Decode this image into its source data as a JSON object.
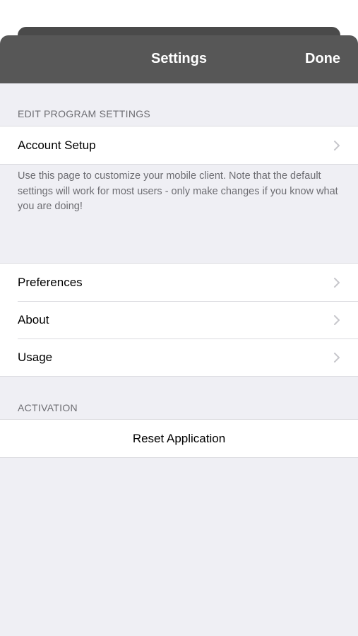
{
  "navbar": {
    "title": "Settings",
    "done_label": "Done"
  },
  "sections": {
    "edit_program": {
      "header": "EDIT PROGRAM SETTINGS",
      "account_setup_label": "Account Setup",
      "footer": "Use this page to customize your mobile client. Note that the default settings will work for most users - only make changes if you know what you are doing!"
    },
    "general": {
      "items": [
        {
          "label": "Preferences"
        },
        {
          "label": "About"
        },
        {
          "label": "Usage"
        }
      ]
    },
    "activation": {
      "header": "ACTIVATION",
      "reset_label": "Reset Application"
    }
  },
  "icons": {
    "chevron": "chevron-right-icon"
  },
  "colors": {
    "navbar_bg": "#575757",
    "background": "#efeff4",
    "secondary_text": "#6d6d72",
    "chevron": "#c7c7cc"
  }
}
